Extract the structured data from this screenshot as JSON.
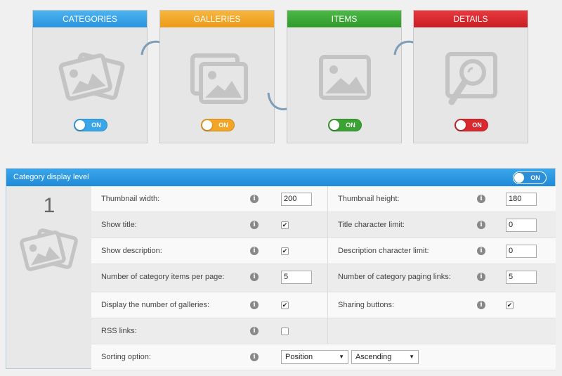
{
  "steps": [
    {
      "title": "CATEGORIES",
      "toggle": "ON",
      "color": "#3aa6ea",
      "icon": "photos-icon"
    },
    {
      "title": "GALLERIES",
      "toggle": "ON",
      "color": "#f2a526",
      "icon": "gallery-icon"
    },
    {
      "title": "ITEMS",
      "toggle": "ON",
      "color": "#3aa334",
      "icon": "image-icon"
    },
    {
      "title": "DETAILS",
      "toggle": "ON",
      "color": "#d9282e",
      "icon": "zoom-image-icon"
    }
  ],
  "panel": {
    "title": "Category display level",
    "toggle": "ON",
    "level": "1"
  },
  "settings": {
    "thumb_width": {
      "label": "Thumbnail width:",
      "value": "200"
    },
    "thumb_height": {
      "label": "Thumbnail height:",
      "value": "180"
    },
    "show_title": {
      "label": "Show title:",
      "checked": true
    },
    "title_limit": {
      "label": "Title character limit:",
      "value": "0"
    },
    "show_desc": {
      "label": "Show description:",
      "checked": true
    },
    "desc_limit": {
      "label": "Description character limit:",
      "value": "0"
    },
    "items_per_page": {
      "label": "Number of category items per page:",
      "value": "5"
    },
    "paging_links": {
      "label": "Number of category paging links:",
      "value": "5"
    },
    "num_galleries": {
      "label": "Display the number of galleries:",
      "checked": true
    },
    "sharing": {
      "label": "Sharing buttons:",
      "checked": true
    },
    "rss": {
      "label": "RSS links:",
      "checked": false
    },
    "sorting": {
      "label": "Sorting option:",
      "field": "Position",
      "order": "Ascending"
    }
  },
  "info_glyph": "i",
  "check_glyph": "✔",
  "caret_glyph": "▼"
}
